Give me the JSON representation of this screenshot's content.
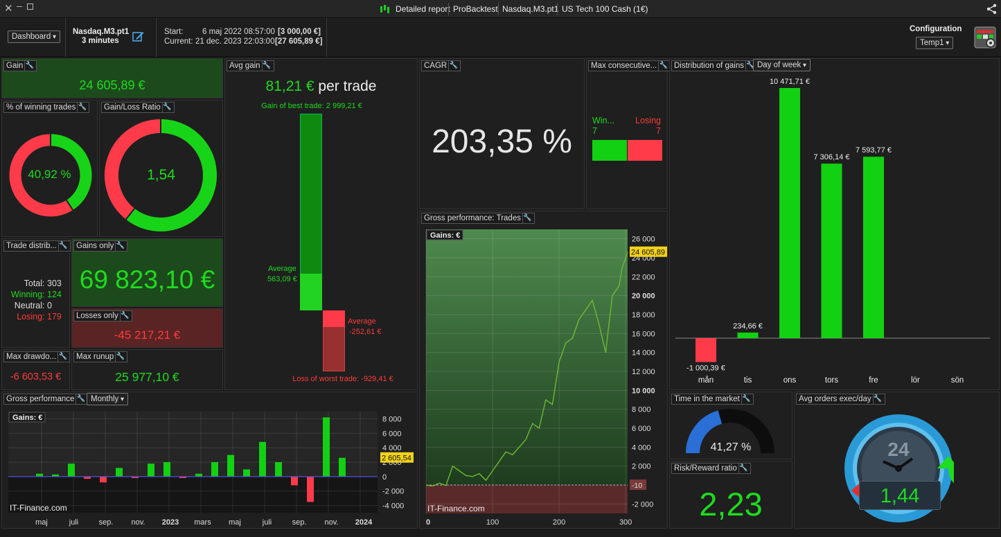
{
  "titlebar": {
    "tabs": [
      "Detailed report",
      "ProBacktest",
      "Nasdaq.M3.pt1",
      "US Tech 100 Cash (1€)"
    ]
  },
  "toolbar": {
    "view_select": "Dashboard",
    "system_name": "Nasdaq.M3.pt1",
    "timeframe": "3 minutes",
    "start_label": "Start:",
    "start_date": "6 maj 2022 08:57:00",
    "start_capital": "[3 000,00 €]",
    "current_label": "Current:",
    "current_date": "21 dec. 2023 22:03:00",
    "current_capital": "[27 605,89 €]",
    "config_label": "Configuration",
    "config_select": "Temp1"
  },
  "gain": {
    "title": "Gain",
    "value": "24 605,89 €"
  },
  "winning_pct": {
    "title": "% of winning trades",
    "value": "40,92 %",
    "fraction": 0.4092
  },
  "gain_loss_ratio": {
    "title": "Gain/Loss Ratio",
    "value": "1,54",
    "fraction": 0.6063
  },
  "trade_distrib": {
    "title": "Trade distrib...",
    "total_label": "Total:",
    "total": "303",
    "winning_label": "Winning:",
    "winning": "124",
    "neutral_label": "Neutral:",
    "neutral": "0",
    "losing_label": "Losing:",
    "losing": "179"
  },
  "gains_only": {
    "title": "Gains only",
    "value": "69 823,10 €"
  },
  "losses_only": {
    "title": "Losses only",
    "value": "-45 217,21 €"
  },
  "max_drawdown": {
    "title": "Max drawdo...",
    "value": "-6 603,53 €"
  },
  "max_runup": {
    "title": "Max runup",
    "value": "25 977,10 €"
  },
  "avg_gain": {
    "title": "Avg gain",
    "value": "81,21 €",
    "unit": "per trade",
    "best_trade": "Gain of best trade: 2 999,21 €",
    "avg_gain_label": "Average",
    "avg_gain_value": "563,09 €",
    "avg_loss_label": "Average",
    "avg_loss_value": "-252,61 €",
    "worst_trade": "Loss of worst trade: -929,41 €",
    "best_value": 2999.21,
    "avg_win": 563.09,
    "avg_loss": -252.61,
    "worst_value": -929.41
  },
  "cagr": {
    "title": "CAGR",
    "value": "203,35 %"
  },
  "max_consecutive": {
    "title": "Max consecutive...",
    "win_label": "Win...",
    "win_value": "7",
    "lose_label": "Losing",
    "lose_value": "7"
  },
  "distribution": {
    "title": "Distribution of gains",
    "select": "Day of week",
    "chart_data": {
      "type": "bar",
      "categories": [
        "mån",
        "tis",
        "ons",
        "tors",
        "fre",
        "lör",
        "sön"
      ],
      "values": [
        -1000.39,
        234.66,
        10471.71,
        7306.14,
        7593.77,
        0,
        0
      ],
      "value_labels": [
        "-1 000,39 €",
        "234,66 €",
        "10 471,71 €",
        "7 306,14 €",
        "7 593,77 €",
        "",
        ""
      ]
    }
  },
  "gross_trades": {
    "title": "Gross performance: Trades",
    "series_label": "Gains: €",
    "watermark": "IT-Finance.com",
    "last_value_label": "24 605,89",
    "zero_marker": "-10",
    "chart_data": {
      "type": "line",
      "xlim": [
        0,
        303
      ],
      "ylim": [
        -3000,
        27000
      ],
      "x_ticks": [
        "0",
        "100",
        "200",
        "300"
      ],
      "y_ticks": [
        "26 000",
        "24 000",
        "22 000",
        "20 000",
        "18 000",
        "16 000",
        "14 000",
        "12 000",
        "10 000",
        "8 000",
        "6 000",
        "4 000",
        "2 000",
        "-2 000"
      ],
      "y_tick_values": [
        26000,
        24000,
        22000,
        20000,
        18000,
        16000,
        14000,
        12000,
        10000,
        8000,
        6000,
        4000,
        2000,
        -2000
      ],
      "x": [
        0,
        10,
        20,
        30,
        40,
        50,
        60,
        70,
        80,
        90,
        100,
        110,
        120,
        130,
        140,
        150,
        160,
        170,
        180,
        190,
        200,
        210,
        220,
        230,
        240,
        250,
        260,
        270,
        280,
        290,
        295,
        303
      ],
      "values": [
        -10,
        -100,
        200,
        -50,
        2000,
        1500,
        1000,
        900,
        1200,
        500,
        1500,
        2500,
        3500,
        3200,
        4000,
        4800,
        6500,
        6000,
        9000,
        8500,
        13000,
        15000,
        15500,
        17500,
        18500,
        19500,
        17000,
        14000,
        20000,
        21000,
        23000,
        24605.89
      ]
    }
  },
  "gross_monthly": {
    "title": "Gross performance",
    "select": "Monthly",
    "series_label": "Gains: €",
    "watermark": "IT-Finance.com",
    "last_value_label": "2 605,54",
    "chart_data": {
      "type": "bar",
      "ylim": [
        -5000,
        9000
      ],
      "y_ticks": [
        "8 000",
        "6 000",
        "4 000",
        "2 000",
        "0",
        "-2 000",
        "-4 000"
      ],
      "y_tick_values": [
        8000,
        6000,
        4000,
        2000,
        0,
        -2000,
        -4000
      ],
      "x_labels": [
        "maj",
        "juli",
        "sep.",
        "nov.",
        "2023",
        "mars",
        "maj",
        "juli",
        "sep.",
        "nov.",
        "2024"
      ],
      "values": [
        400,
        300,
        1800,
        -300,
        -800,
        1200,
        -200,
        1800,
        2000,
        -200,
        400,
        2000,
        3000,
        1000,
        4800,
        2000,
        -1200,
        -3500,
        8200,
        2605.54
      ]
    }
  },
  "time_in_market": {
    "title": "Time in the market",
    "value": "41,27 %",
    "fraction": 0.4127
  },
  "risk_reward": {
    "title": "Risk/Reward ratio",
    "value": "2,23"
  },
  "avg_orders": {
    "title": "Avg orders exec/day",
    "value": "1,44",
    "dial_label": "24"
  }
}
